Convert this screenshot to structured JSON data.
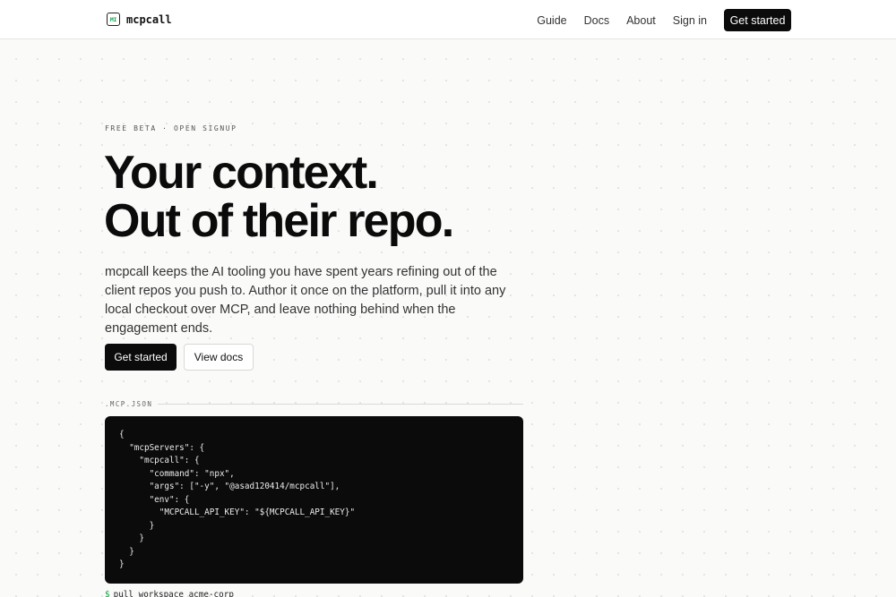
{
  "nav": {
    "brand_logo_text": "MI",
    "brand_name": "mcpcall",
    "links": [
      "Guide",
      "Docs",
      "About",
      "Sign in"
    ],
    "cta": "Get started"
  },
  "hero": {
    "eyebrow": "FREE BETA · OPEN SIGNUP",
    "headline_line1": "Your context.",
    "headline_line2": "Out of their repo.",
    "lead": "mcpcall keeps the AI tooling you have spent years refining out of the client repos you push to. Author it once on the platform, pull it into any local checkout over MCP, and leave nothing behind when the engagement ends.",
    "primary_button": "Get started",
    "secondary_button": "View docs"
  },
  "config": {
    "filename": ".MCP.JSON",
    "code_lines": [
      "{",
      "  \"mcpServers\": {",
      "    \"mcpcall\": {",
      "      \"command\": \"npx\",",
      "      \"args\": [\"-y\", \"@asad120414/mcpcall\"],",
      "      \"env\": {",
      "        \"MCPCALL_API_KEY\": \"${MCPCALL_API_KEY}\"",
      "      }",
      "    }",
      "  }",
      "}"
    ]
  },
  "terminal": {
    "prompt": "$",
    "command": "pull workspace acme-corp"
  },
  "colors": {
    "accent_green": "#16a34a",
    "dark": "#0b0b0b",
    "background": "#fafaf9"
  }
}
